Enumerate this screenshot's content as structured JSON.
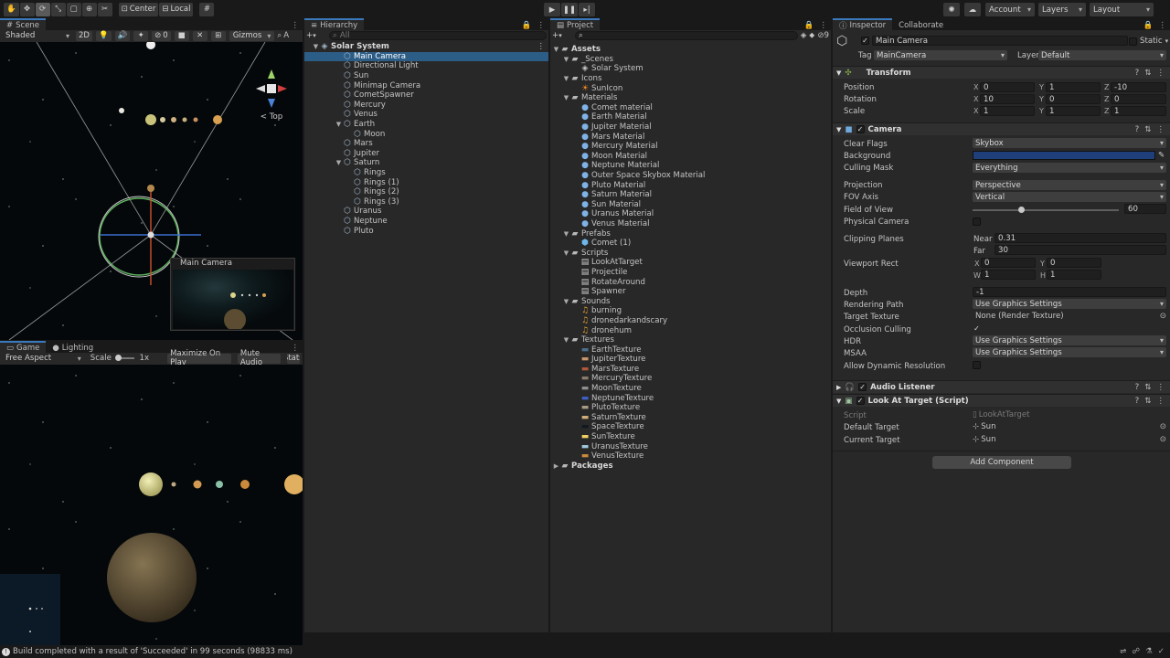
{
  "toolbar": {
    "center_label": "Center",
    "local_label": "Local",
    "account_label": "Account",
    "layers_label": "Layers",
    "layout_label": "Layout"
  },
  "scene": {
    "tab_label": "Scene",
    "shading_mode": "Shaded",
    "mode_2d": "2D",
    "hidden_count": "0",
    "gizmos_label": "Gizmos",
    "search_prefix": "A",
    "view_label": "< Top",
    "camera_preview_title": "Main Camera"
  },
  "game": {
    "tab_label": "Game",
    "lighting_tab_label": "Lighting",
    "aspect": "Free Aspect",
    "scale_label": "Scale",
    "scale_value": "1x",
    "maximize_label": "Maximize On Play",
    "mute_label": "Mute Audio",
    "stats_label": "Stats"
  },
  "hierarchy": {
    "tab_label": "Hierarchy",
    "search_placeholder": "All",
    "items": [
      {
        "label": "Solar System",
        "depth": 0,
        "expanded": true,
        "root": true
      },
      {
        "label": "Main Camera",
        "depth": 1,
        "selected": true
      },
      {
        "label": "Directional Light",
        "depth": 1
      },
      {
        "label": "Sun",
        "depth": 1
      },
      {
        "label": "Minimap Camera",
        "depth": 1
      },
      {
        "label": "CometSpawner",
        "depth": 1
      },
      {
        "label": "Mercury",
        "depth": 1
      },
      {
        "label": "Venus",
        "depth": 1
      },
      {
        "label": "Earth",
        "depth": 1,
        "expanded": true
      },
      {
        "label": "Moon",
        "depth": 2
      },
      {
        "label": "Mars",
        "depth": 1
      },
      {
        "label": "Jupiter",
        "depth": 1
      },
      {
        "label": "Saturn",
        "depth": 1,
        "expanded": true
      },
      {
        "label": "Rings",
        "depth": 2
      },
      {
        "label": "Rings (1)",
        "depth": 2
      },
      {
        "label": "Rings (2)",
        "depth": 2
      },
      {
        "label": "Rings (3)",
        "depth": 2
      },
      {
        "label": "Uranus",
        "depth": 1
      },
      {
        "label": "Neptune",
        "depth": 1
      },
      {
        "label": "Pluto",
        "depth": 1
      }
    ]
  },
  "project": {
    "tab_label": "Project",
    "hidden_count": "9",
    "items": [
      {
        "label": "Assets",
        "depth": 0,
        "kind": "folder",
        "expanded": true,
        "bold": true
      },
      {
        "label": "_Scenes",
        "depth": 1,
        "kind": "folder",
        "expanded": true
      },
      {
        "label": "Solar System",
        "depth": 2,
        "kind": "scene"
      },
      {
        "label": "Icons",
        "depth": 1,
        "kind": "folder",
        "expanded": true
      },
      {
        "label": "SunIcon",
        "depth": 2,
        "kind": "icon"
      },
      {
        "label": "Materials",
        "depth": 1,
        "kind": "folder",
        "expanded": true
      },
      {
        "label": "Comet material",
        "depth": 2,
        "kind": "material"
      },
      {
        "label": "Earth Material",
        "depth": 2,
        "kind": "material"
      },
      {
        "label": "Jupiter Material",
        "depth": 2,
        "kind": "material"
      },
      {
        "label": "Mars Material",
        "depth": 2,
        "kind": "material"
      },
      {
        "label": "Mercury Material",
        "depth": 2,
        "kind": "material"
      },
      {
        "label": "Moon Material",
        "depth": 2,
        "kind": "material"
      },
      {
        "label": "Neptune Material",
        "depth": 2,
        "kind": "material"
      },
      {
        "label": "Outer Space Skybox Material",
        "depth": 2,
        "kind": "material"
      },
      {
        "label": "Pluto Material",
        "depth": 2,
        "kind": "material"
      },
      {
        "label": "Saturn Material",
        "depth": 2,
        "kind": "material"
      },
      {
        "label": "Sun Material",
        "depth": 2,
        "kind": "material"
      },
      {
        "label": "Uranus Material",
        "depth": 2,
        "kind": "material"
      },
      {
        "label": "Venus Material",
        "depth": 2,
        "kind": "material"
      },
      {
        "label": "Prefabs",
        "depth": 1,
        "kind": "folder",
        "expanded": true
      },
      {
        "label": "Comet (1)",
        "depth": 2,
        "kind": "prefab"
      },
      {
        "label": "Scripts",
        "depth": 1,
        "kind": "folder",
        "expanded": true
      },
      {
        "label": "LookAtTarget",
        "depth": 2,
        "kind": "script"
      },
      {
        "label": "Projectile",
        "depth": 2,
        "kind": "script"
      },
      {
        "label": "RotateAround",
        "depth": 2,
        "kind": "script"
      },
      {
        "label": "Spawner",
        "depth": 2,
        "kind": "script"
      },
      {
        "label": "Sounds",
        "depth": 1,
        "kind": "folder",
        "expanded": true
      },
      {
        "label": "burning",
        "depth": 2,
        "kind": "audio"
      },
      {
        "label": "dronedarkandscary",
        "depth": 2,
        "kind": "audio"
      },
      {
        "label": "dronehum",
        "depth": 2,
        "kind": "audio"
      },
      {
        "label": "Textures",
        "depth": 1,
        "kind": "folder",
        "expanded": true
      },
      {
        "label": "EarthTexture",
        "depth": 2,
        "kind": "texture",
        "color": "#4d6e8a"
      },
      {
        "label": "JupiterTexture",
        "depth": 2,
        "kind": "texture",
        "color": "#c9956a"
      },
      {
        "label": "MarsTexture",
        "depth": 2,
        "kind": "texture",
        "color": "#b0583a"
      },
      {
        "label": "MercuryTexture",
        "depth": 2,
        "kind": "texture",
        "color": "#8a7c6b"
      },
      {
        "label": "MoonTexture",
        "depth": 2,
        "kind": "texture",
        "color": "#8f8f8f"
      },
      {
        "label": "NeptuneTexture",
        "depth": 2,
        "kind": "texture",
        "color": "#3d5fc4"
      },
      {
        "label": "PlutoTexture",
        "depth": 2,
        "kind": "texture",
        "color": "#a99a86"
      },
      {
        "label": "SaturnTexture",
        "depth": 2,
        "kind": "texture",
        "color": "#cfae7a"
      },
      {
        "label": "SpaceTexture",
        "depth": 2,
        "kind": "texture",
        "color": "#101820"
      },
      {
        "label": "SunTexture",
        "depth": 2,
        "kind": "texture",
        "color": "#f0d060"
      },
      {
        "label": "UranusTexture",
        "depth": 2,
        "kind": "texture",
        "color": "#9fc8d8"
      },
      {
        "label": "VenusTexture",
        "depth": 2,
        "kind": "texture",
        "color": "#c98a3c"
      },
      {
        "label": "Packages",
        "depth": 0,
        "kind": "folder",
        "expanded": false,
        "bold": true
      }
    ]
  },
  "inspector": {
    "tab_label": "Inspector",
    "collab_tab_label": "Collaborate",
    "object_name": "Main Camera",
    "static_label": "Static",
    "tag_label": "Tag",
    "tag_value": "MainCamera",
    "layer_label": "Layer",
    "layer_value": "Default",
    "transform": {
      "title": "Transform",
      "position_label": "Position",
      "rotation_label": "Rotation",
      "scale_label": "Scale",
      "position": {
        "x": "0",
        "y": "1",
        "z": "-10"
      },
      "rotation": {
        "x": "10",
        "y": "0",
        "z": "0"
      },
      "scale": {
        "x": "1",
        "y": "1",
        "z": "1"
      }
    },
    "camera": {
      "title": "Camera",
      "clear_flags_label": "Clear Flags",
      "clear_flags": "Skybox",
      "background_label": "Background",
      "background_color": "#1f3f7a",
      "culling_mask_label": "Culling Mask",
      "culling_mask": "Everything",
      "projection_label": "Projection",
      "projection": "Perspective",
      "fov_axis_label": "FOV Axis",
      "fov_axis": "Vertical",
      "fov_label": "Field of View",
      "fov_value": "60",
      "fov_fraction": 0.333,
      "physical_label": "Physical Camera",
      "clipping_label": "Clipping Planes",
      "near_label": "Near",
      "near": "0.31",
      "far_label": "Far",
      "far": "30",
      "viewport_label": "Viewport Rect",
      "vx": "0",
      "vy": "0",
      "vw": "1",
      "vh": "1",
      "depth_label": "Depth",
      "depth": "-1",
      "rendering_path_label": "Rendering Path",
      "rendering_path": "Use Graphics Settings",
      "target_texture_label": "Target Texture",
      "target_texture": "None (Render Texture)",
      "occlusion_label": "Occlusion Culling",
      "hdr_label": "HDR",
      "hdr": "Use Graphics Settings",
      "msaa_label": "MSAA",
      "msaa": "Use Graphics Settings",
      "dynres_label": "Allow Dynamic Resolution"
    },
    "audio_listener_title": "Audio Listener",
    "look_at": {
      "title": "Look At Target (Script)",
      "script_label": "Script",
      "script_value": "LookAtTarget",
      "default_target_label": "Default Target",
      "default_target": "Sun",
      "current_target_label": "Current Target",
      "current_target": "Sun"
    },
    "add_component_label": "Add Component"
  },
  "status": {
    "message": "Build completed with a result of 'Succeeded' in 99 seconds (98833 ms)"
  }
}
